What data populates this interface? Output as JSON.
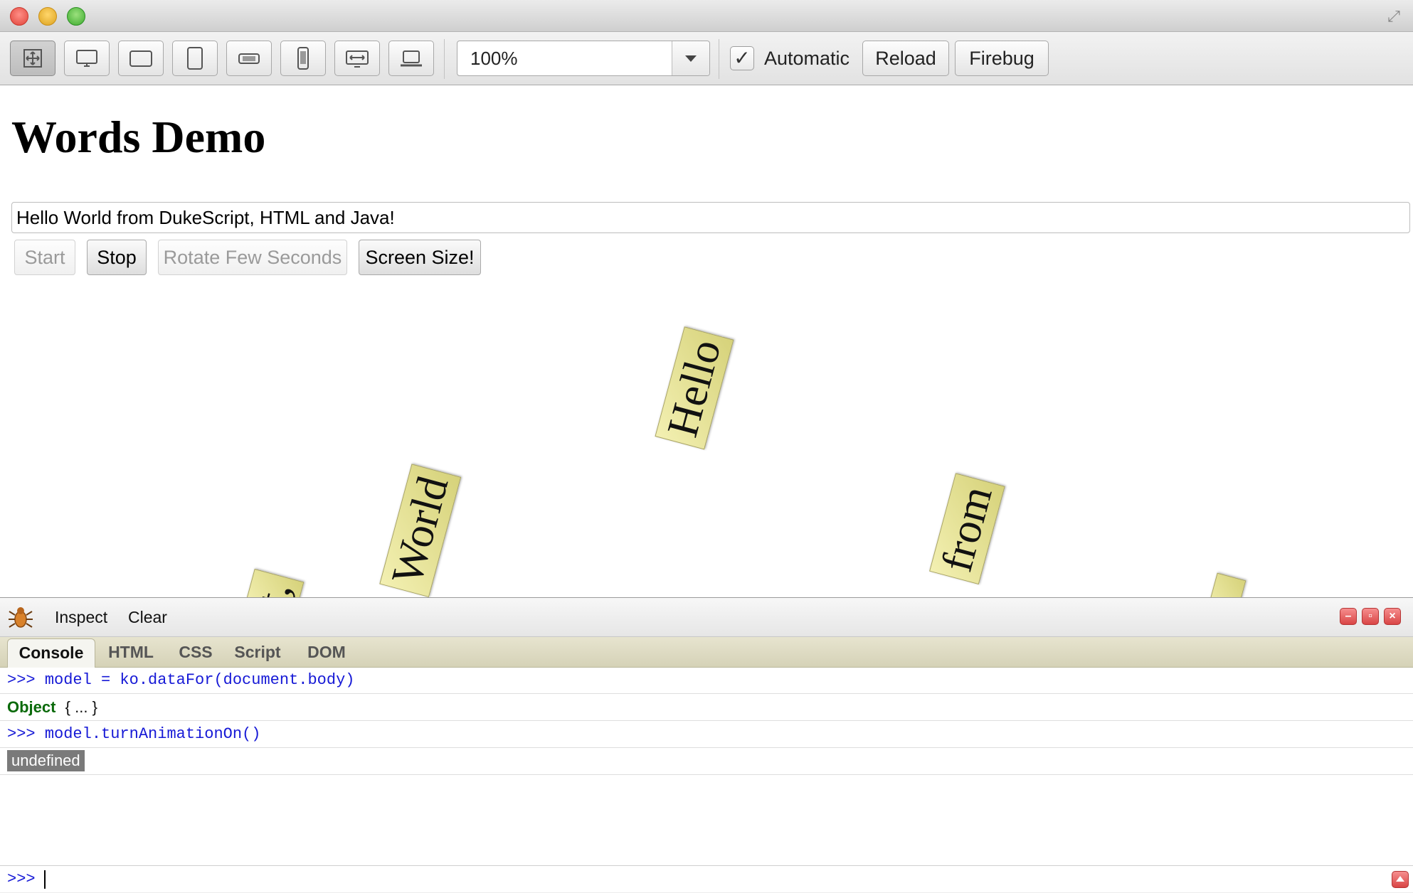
{
  "toolbar": {
    "device_icons": [
      "move-resize-icon",
      "desktop-icon",
      "tablet-landscape-icon",
      "tablet-portrait-icon",
      "phone-landscape-icon",
      "phone-portrait-icon",
      "widescreen-icon",
      "laptop-icon"
    ],
    "zoom_value": "100%",
    "automatic_checked": true,
    "automatic_label": "Automatic",
    "reload_label": "Reload",
    "firebug_label": "Firebug"
  },
  "page": {
    "title": "Words Demo",
    "input_value": "Hello World from DukeScript, HTML and Java!",
    "buttons": {
      "start": "Start",
      "stop": "Stop",
      "rotate": "Rotate Few Seconds",
      "screen_size": "Screen Size!"
    },
    "words": {
      "hello": "Hello",
      "world": "World",
      "from": "from",
      "partial": "t,"
    }
  },
  "firebug": {
    "inspect": "Inspect",
    "clear": "Clear",
    "tabs": [
      "Console",
      "HTML",
      "CSS",
      "Script",
      "DOM"
    ],
    "active_tab": "Console",
    "console": {
      "line1_prompt": ">>>",
      "line1_cmd": "model = ko.dataFor(document.body)",
      "line2_keyword": "Object",
      "line2_rest": "{ ... }",
      "line3_prompt": ">>>",
      "line3_cmd": "model.turnAnimationOn()",
      "line4_result": "undefined"
    },
    "command_prompt": ">>>"
  },
  "colors": {
    "word_fill": "#e8e49a",
    "console_command": "#1619d6",
    "console_object": "#0a6a0a"
  }
}
